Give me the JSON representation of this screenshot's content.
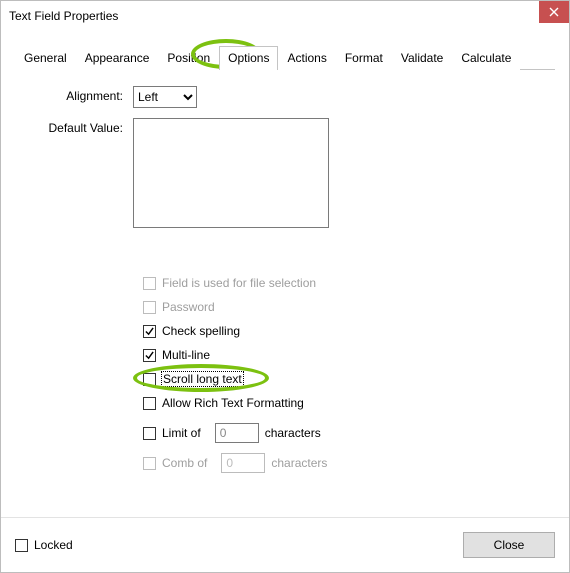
{
  "window": {
    "title": "Text Field Properties"
  },
  "tabs": {
    "items": [
      {
        "label": "General"
      },
      {
        "label": "Appearance"
      },
      {
        "label": "Position"
      },
      {
        "label": "Options"
      },
      {
        "label": "Actions"
      },
      {
        "label": "Format"
      },
      {
        "label": "Validate"
      },
      {
        "label": "Calculate"
      }
    ],
    "active_index": 3
  },
  "form": {
    "alignment_label": "Alignment:",
    "alignment_value": "Left",
    "default_value_label": "Default Value:",
    "default_value": ""
  },
  "checkboxes": {
    "file_selection": "Field is used for file selection",
    "password": "Password",
    "check_spelling": "Check spelling",
    "multiline": "Multi-line",
    "scroll_long_text": "Scroll long text",
    "rich_text": "Allow Rich Text Formatting",
    "limit_of": "Limit of",
    "limit_suffix": "characters",
    "limit_value": "0",
    "comb_of": "Comb of",
    "comb_suffix": "characters",
    "comb_value": "0"
  },
  "footer": {
    "locked_label": "Locked",
    "close_label": "Close"
  },
  "annotations": {
    "highlight_color": "#7cc110"
  }
}
